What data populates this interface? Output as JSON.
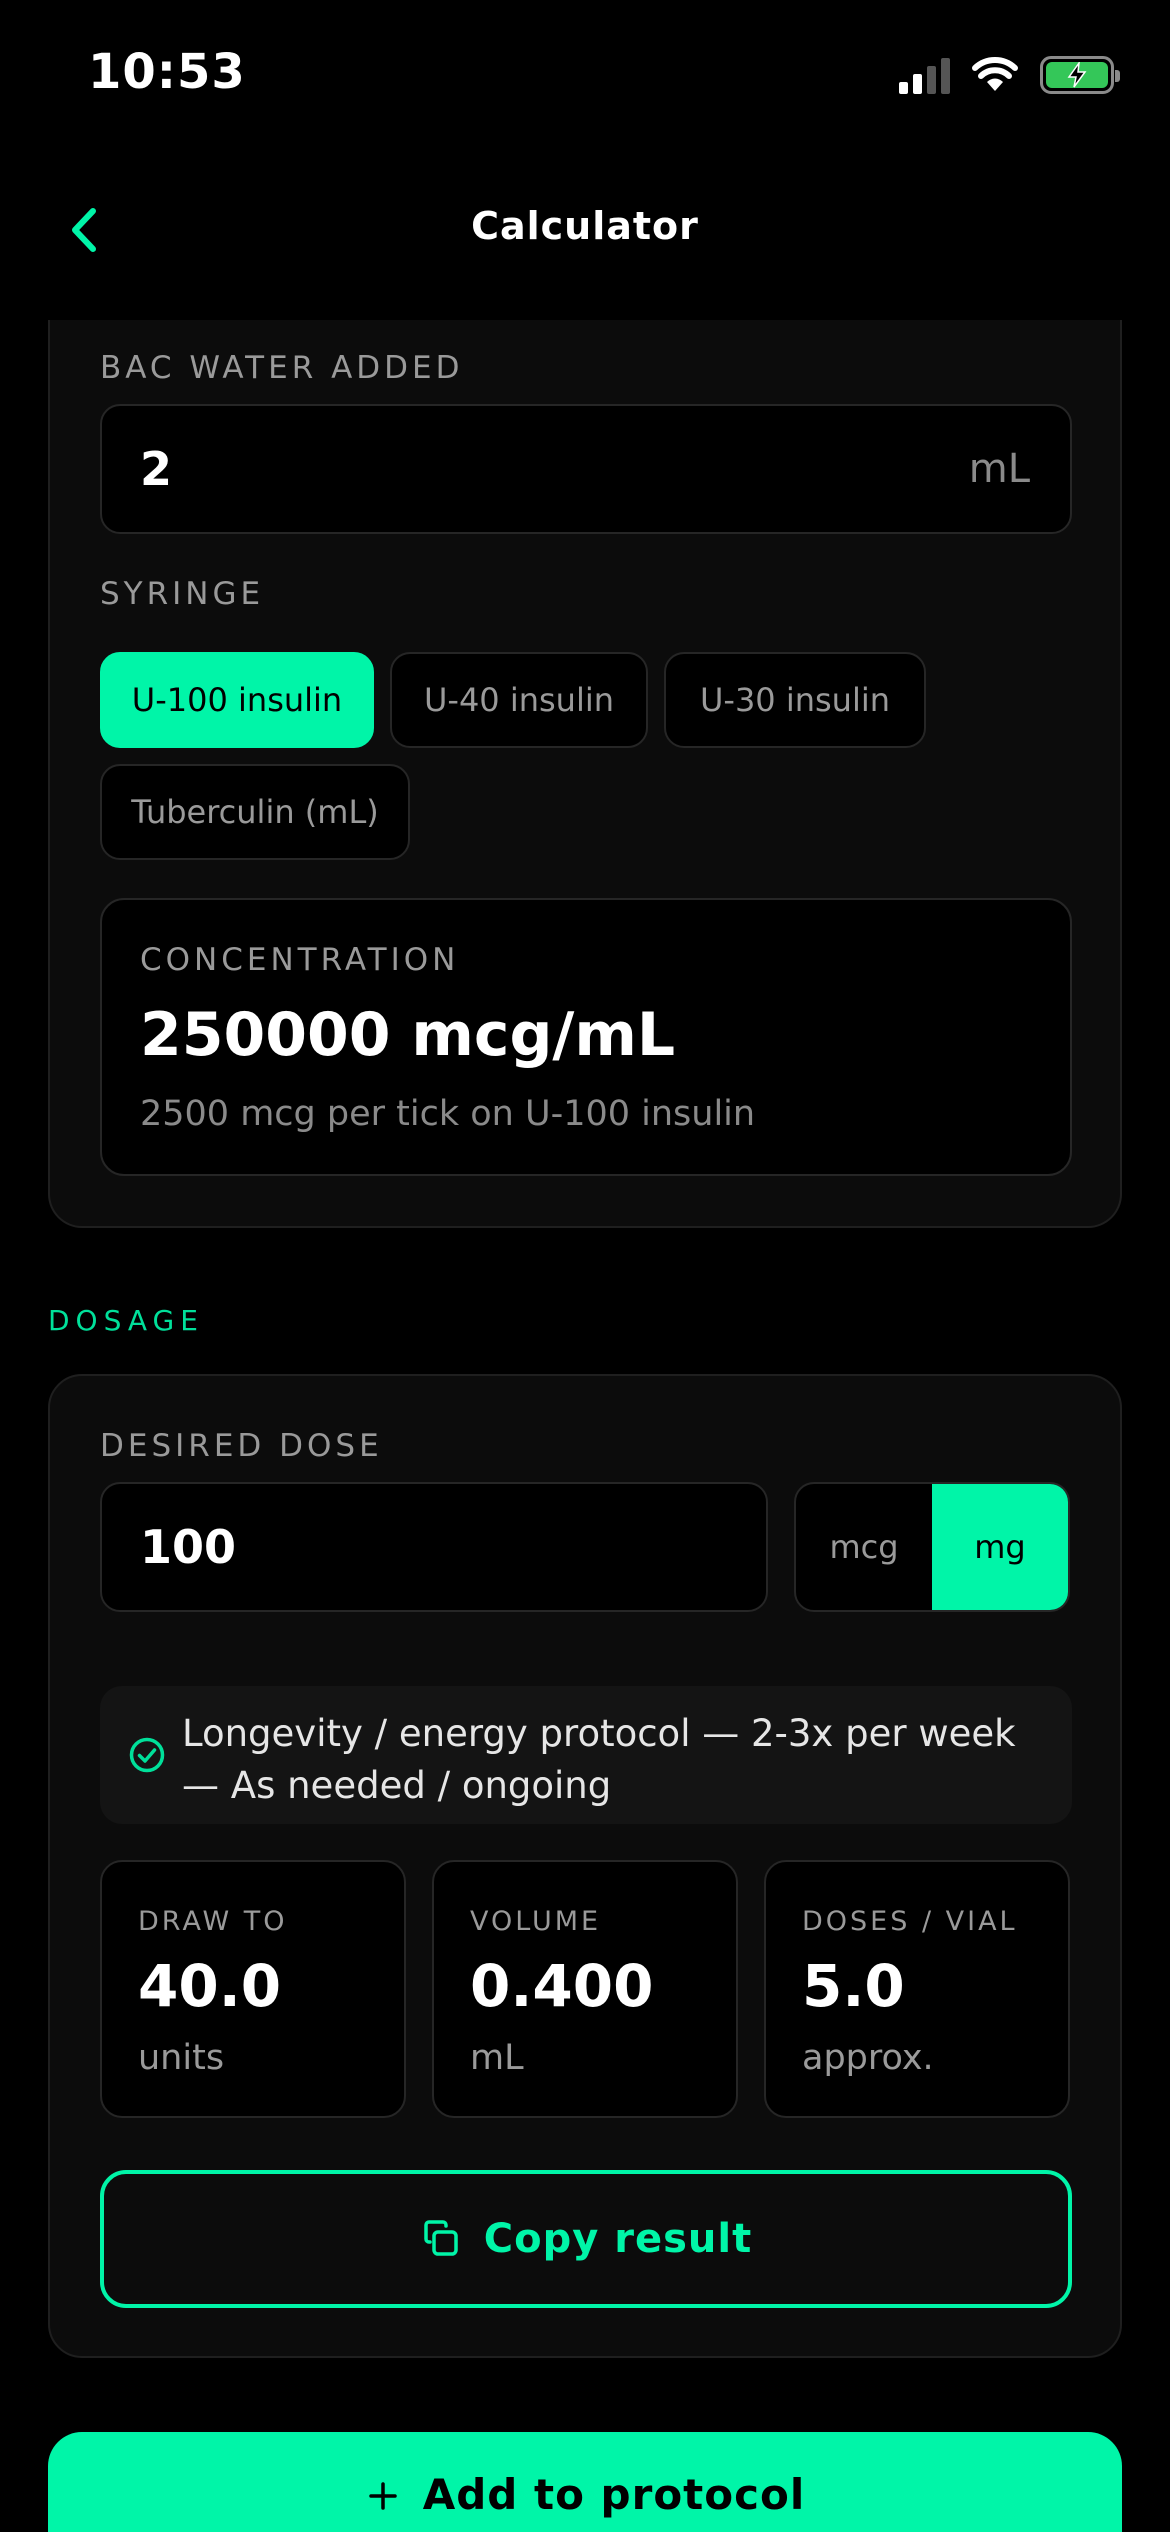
{
  "status_bar": {
    "time": "10:53"
  },
  "nav": {
    "title": "Calculator"
  },
  "reconstitution": {
    "bac_water_label": "BAC WATER ADDED",
    "bac_water_value": "2",
    "bac_water_unit": "mL",
    "syringe_label": "SYRINGE",
    "syringe_options": [
      "U-100 insulin",
      "U-40 insulin",
      "U-30 insulin",
      "Tuberculin (mL)"
    ],
    "syringe_selected": "U-100 insulin",
    "concentration_label": "CONCENTRATION",
    "concentration_value": "250000 mcg/mL",
    "concentration_sub": "2500 mcg per tick on U-100 insulin"
  },
  "dosage": {
    "section_title": "DOSAGE",
    "desired_dose_label": "DESIRED DOSE",
    "desired_dose_value": "100",
    "units": [
      "mcg",
      "mg"
    ],
    "unit_selected": "mg",
    "protocol_note": "Longevity / energy protocol — 2-3x per week — As needed / ongoing",
    "stats": [
      {
        "label": "DRAW TO",
        "value": "40.0",
        "unit": "units"
      },
      {
        "label": "VOLUME",
        "value": "0.400",
        "unit": "mL"
      },
      {
        "label": "DOSES / VIAL",
        "value": "5.0",
        "unit": "approx."
      }
    ],
    "copy_label": "Copy result"
  },
  "add_to_protocol_label": "Add to protocol",
  "colors": {
    "accent": "#00f5a8",
    "background": "#000000",
    "card": "#0c0c0c"
  }
}
